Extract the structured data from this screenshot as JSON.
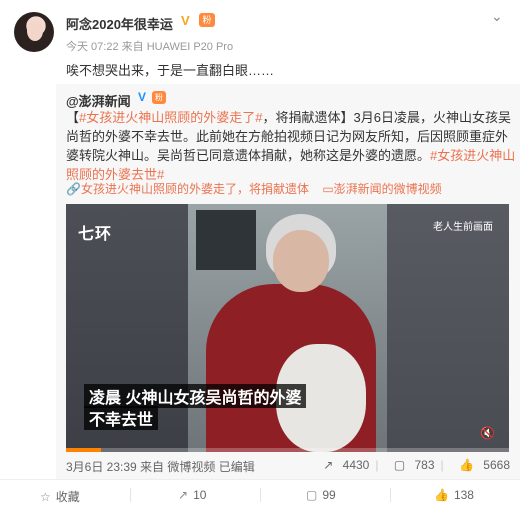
{
  "post": {
    "username": "阿念2020年很幸运",
    "verified_mark": "V",
    "badge": "粉",
    "meta": "今天 07:22 来自 HUAWEI P20 Pro",
    "text": "唉不想哭出来，于是一直翻白眼……"
  },
  "repost": {
    "source_user": "@澎湃新闻",
    "source_verified": "V",
    "source_badge": "粉",
    "text_tag1": "#女孩进火神山照顾的外婆走了#",
    "text_body1": "，将捐献遗体】3月6日凌晨，火神山女孩吴尚哲的外婆不幸去世。此前她在方舱拍视频日记为网友所知，后因照顾重症外婆转院火神山。吴尚哲已同意遗体捐献，她称这是外婆的遗愿。",
    "text_prefix": "【",
    "text_tag2": "#女孩进火神山照顾的外婆去世#",
    "link1": "女孩进火神山照顾的外婆走了，将捐献遗体",
    "link2": "澎湃新闻的微博视频",
    "video": {
      "logo": "七环",
      "tag": "老人生前画面",
      "caption_line1": "凌晨 火神山女孩吴尚哲的外婆",
      "caption_line2": "不幸去世",
      "progress_pct": 8
    },
    "footer": "3月6日 23:39 来自 微博视频",
    "footer_edit": "已编辑",
    "stats": {
      "share": "4430",
      "comment": "783",
      "like": "5668"
    }
  },
  "actions": {
    "favorite": "收藏",
    "repost": "10",
    "comment": "99",
    "like": "138"
  },
  "colors": {
    "accent": "#eb7350",
    "verified": "#f5a623",
    "media_verified": "#1e90ff"
  }
}
